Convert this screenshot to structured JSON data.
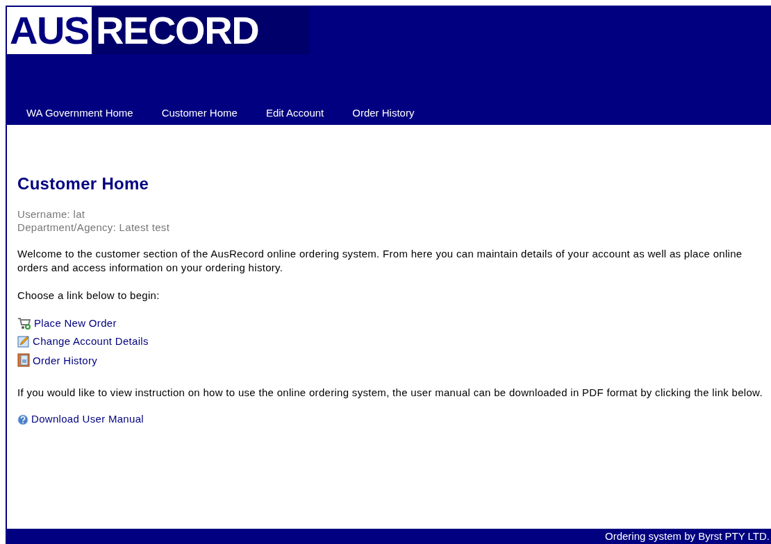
{
  "logo": {
    "part_1": "AUS",
    "part_2": "RECORD"
  },
  "nav": [
    {
      "label": "WA Government Home"
    },
    {
      "label": "Customer Home"
    },
    {
      "label": "Edit Account"
    },
    {
      "label": "Order History"
    }
  ],
  "heading": "Customer Home",
  "user_info": [
    "Username: lat",
    "Department/Agency: Latest test"
  ],
  "intro": "Welcome to the customer section of the AusRecord online ordering system. From here you can maintain details of your account as well as place online orders and access information on your ordering history.",
  "prompt": "Choose a link below to begin:",
  "links": [
    {
      "label": "Place New Order",
      "kind": "cart"
    },
    {
      "label": "Change Account Details",
      "kind": "edit"
    },
    {
      "label": "Order History",
      "kind": "book"
    }
  ],
  "manual_text": "If you would like to view instruction on how to use the online ordering system, the user manual can be downloaded in PDF format by clicking the link below.",
  "manual_link": {
    "label": "Download User Manual",
    "kind": "help"
  },
  "footer": "Ordering system by Byrst PTY LTD."
}
